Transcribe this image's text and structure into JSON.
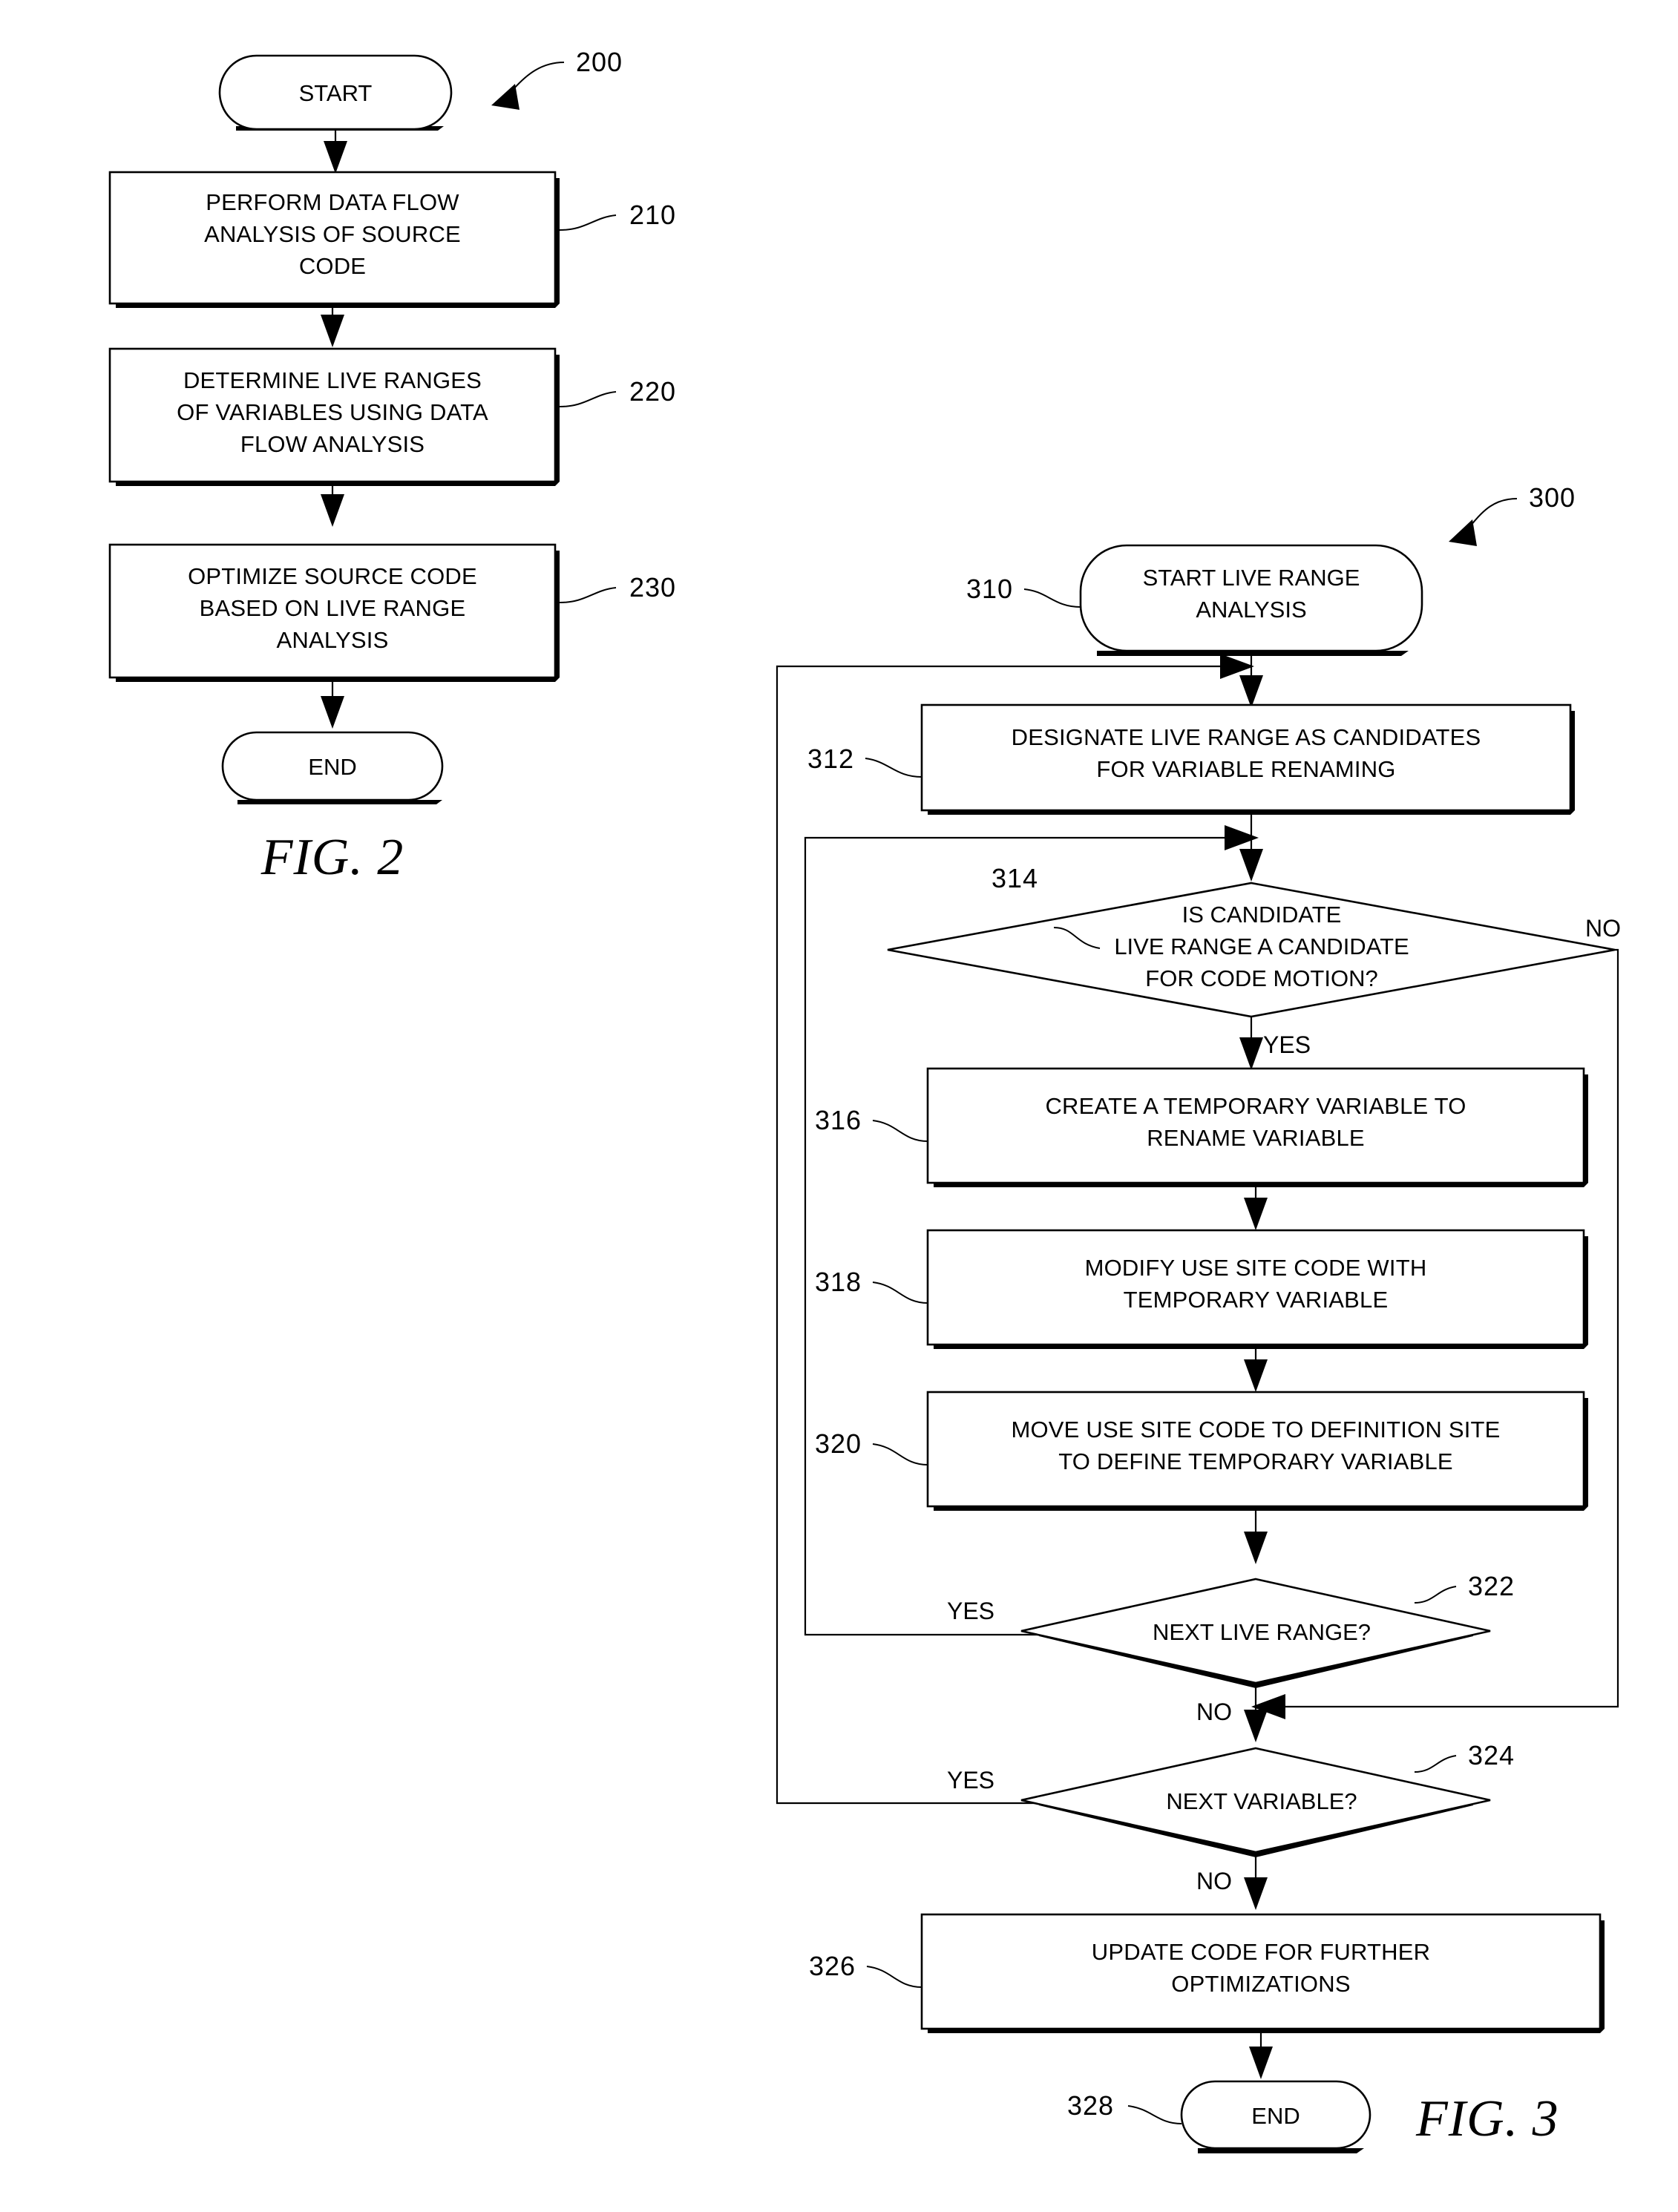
{
  "document": {
    "type": "patent-flowchart-sheet",
    "figures": [
      "FIG. 2",
      "FIG. 3"
    ]
  },
  "fig2": {
    "label": "FIG. 2",
    "ref": "200",
    "nodes": [
      {
        "id": "start",
        "ref": "",
        "shape": "terminator",
        "lines": [
          "START"
        ]
      },
      {
        "id": "210",
        "ref": "210",
        "shape": "process",
        "lines": [
          "PERFORM DATA FLOW",
          "ANALYSIS OF SOURCE",
          "CODE"
        ]
      },
      {
        "id": "220",
        "ref": "220",
        "shape": "process",
        "lines": [
          "DETERMINE LIVE RANGES",
          "OF VARIABLES USING DATA",
          "FLOW ANALYSIS"
        ]
      },
      {
        "id": "230",
        "ref": "230",
        "shape": "process",
        "lines": [
          "OPTIMIZE SOURCE CODE",
          "BASED ON LIVE RANGE",
          "ANALYSIS"
        ]
      },
      {
        "id": "end",
        "ref": "",
        "shape": "terminator",
        "lines": [
          "END"
        ]
      }
    ]
  },
  "fig3": {
    "label": "FIG. 3",
    "ref": "300",
    "nodes": [
      {
        "id": "310",
        "ref": "310",
        "shape": "terminator",
        "lines": [
          "START LIVE RANGE",
          "ANALYSIS"
        ]
      },
      {
        "id": "312",
        "ref": "312",
        "shape": "process",
        "lines": [
          "DESIGNATE LIVE RANGE AS CANDIDATES",
          "FOR VARIABLE RENAMING"
        ]
      },
      {
        "id": "314",
        "ref": "314",
        "shape": "decision",
        "lines": [
          "IS CANDIDATE",
          "LIVE RANGE A CANDIDATE",
          "FOR CODE MOTION?"
        ]
      },
      {
        "id": "316",
        "ref": "316",
        "shape": "process",
        "lines": [
          "CREATE A TEMPORARY VARIABLE TO",
          "RENAME VARIABLE"
        ]
      },
      {
        "id": "318",
        "ref": "318",
        "shape": "process",
        "lines": [
          "MODIFY USE SITE CODE WITH",
          "TEMPORARY VARIABLE"
        ]
      },
      {
        "id": "320",
        "ref": "320",
        "shape": "process",
        "lines": [
          "MOVE USE SITE CODE TO DEFINITION SITE",
          "TO DEFINE TEMPORARY VARIABLE"
        ]
      },
      {
        "id": "322",
        "ref": "322",
        "shape": "decision",
        "lines": [
          "NEXT LIVE RANGE?"
        ]
      },
      {
        "id": "324",
        "ref": "324",
        "shape": "decision",
        "lines": [
          "NEXT VARIABLE?"
        ]
      },
      {
        "id": "326",
        "ref": "326",
        "shape": "process",
        "lines": [
          "UPDATE CODE FOR FURTHER",
          "OPTIMIZATIONS"
        ]
      },
      {
        "id": "328",
        "ref": "328",
        "shape": "terminator",
        "lines": [
          "END"
        ]
      }
    ],
    "branch_labels": {
      "d314_no": "NO",
      "d314_yes": "YES",
      "d322_yes": "YES",
      "d322_no": "NO",
      "d324_yes": "YES",
      "d324_no": "NO"
    }
  },
  "colors": {
    "ink": "#000000",
    "paper": "#ffffff"
  }
}
